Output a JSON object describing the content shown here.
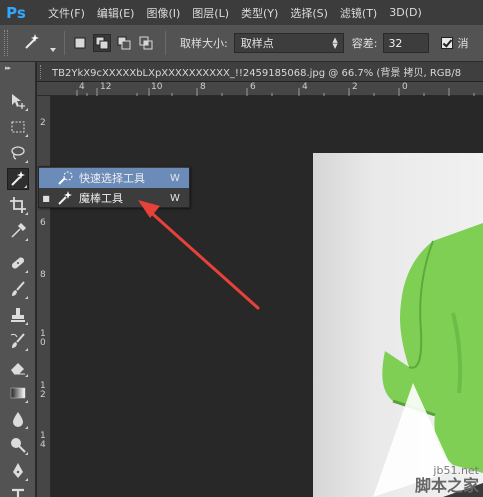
{
  "app": {
    "logo": "Ps"
  },
  "menubar": {
    "items": [
      "文件(F)",
      "编辑(E)",
      "图像(I)",
      "图层(L)",
      "类型(Y)",
      "选择(S)",
      "滤镜(T)",
      "3D(D)"
    ]
  },
  "options": {
    "sample_size_label": "取样大小:",
    "sample_size_value": "取样点",
    "tolerance_label": "容差:",
    "tolerance_value": "32",
    "antialias_label": "消"
  },
  "document": {
    "tab_title": "TB2YkX9cXXXXXbLXpXXXXXXXXXX_!!2459185068.jpg @ 66.7% (背景 拷贝, RGB/8"
  },
  "rulers": {
    "h_ticks": [
      "4",
      "12",
      "10",
      "8",
      "6",
      "4",
      "2",
      "0"
    ],
    "v_ticks": [
      "2",
      "4",
      "6",
      "8",
      "1 0",
      "1 2",
      "1 4"
    ]
  },
  "flyout": {
    "items": [
      {
        "label": "快速选择工具",
        "key": "W",
        "icon": "quick-selection-icon"
      },
      {
        "label": "魔棒工具",
        "key": "W",
        "icon": "magic-wand-icon",
        "selected": true
      }
    ]
  },
  "colors": {
    "accent_arrow": "#e8413a",
    "flyout_hover": "#6b8bb8",
    "shirt_green": "#7fcf55"
  },
  "watermark": {
    "site": "jb51.net",
    "cn": "脚本之家"
  }
}
